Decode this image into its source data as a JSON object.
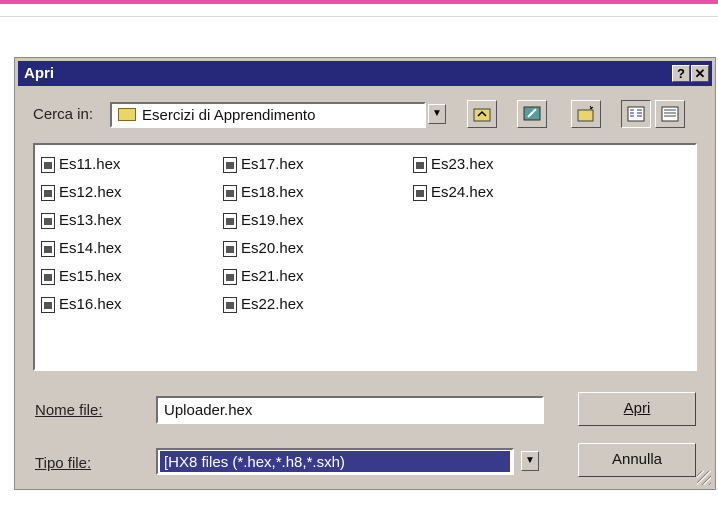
{
  "dialog": {
    "title": "Apri",
    "help_button": "?",
    "close_button": "✕"
  },
  "lookin": {
    "label": "Cerca in:",
    "value": "Esercizi di Apprendimento"
  },
  "toolbar": {
    "icons": [
      "up-folder-icon",
      "desktop-icon",
      "new-folder-icon",
      "list-view-icon",
      "details-view-icon"
    ]
  },
  "files": {
    "col1": [
      "Es11.hex",
      "Es12.hex",
      "Es13.hex",
      "Es14.hex",
      "Es15.hex",
      "Es16.hex"
    ],
    "col2": [
      "Es17.hex",
      "Es18.hex",
      "Es19.hex",
      "Es20.hex",
      "Es21.hex",
      "Es22.hex"
    ],
    "col3": [
      "Es23.hex",
      "Es24.hex"
    ]
  },
  "filename": {
    "label": "Nome file:",
    "value": "Uploader.hex"
  },
  "filetype": {
    "label": "Tipo file:",
    "value": "[HX8 files (*.hex,*.h8,*.sxh)"
  },
  "buttons": {
    "open": "Apri",
    "cancel": "Annulla"
  },
  "colors": {
    "titlebar": "#26287a",
    "dialog_bg": "#cfc9c2",
    "selection": "#3a3a8c"
  }
}
